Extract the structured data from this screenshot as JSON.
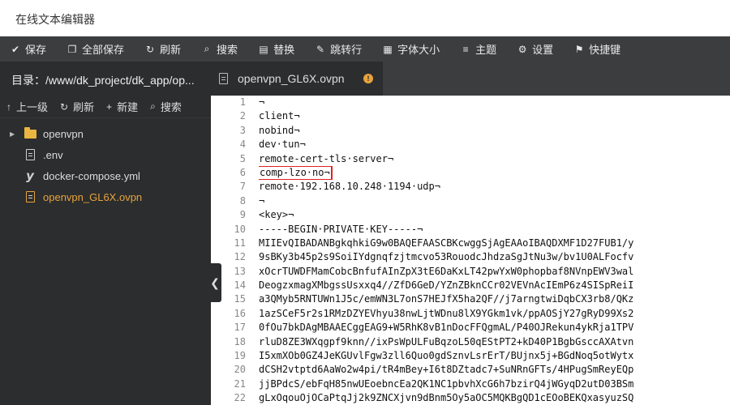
{
  "window": {
    "title": "在线文本编辑器"
  },
  "toolbar": {
    "buttons": [
      {
        "icon": "check-icon",
        "glyph": "✔",
        "label": "保存"
      },
      {
        "icon": "save-all-icon",
        "glyph": "❐",
        "label": "全部保存"
      },
      {
        "icon": "refresh-icon",
        "glyph": "↻",
        "label": "刷新"
      },
      {
        "icon": "search-icon",
        "glyph": "⌕",
        "label": "搜索"
      },
      {
        "icon": "replace-icon",
        "glyph": "▤",
        "label": "替换"
      },
      {
        "icon": "goto-line-icon",
        "glyph": "✎",
        "label": "跳转行"
      },
      {
        "icon": "font-size-icon",
        "glyph": "▦",
        "label": "字体大小"
      },
      {
        "icon": "theme-icon",
        "glyph": "≡",
        "label": "主题"
      },
      {
        "icon": "settings-icon",
        "glyph": "⚙",
        "label": "设置"
      },
      {
        "icon": "shortcut-icon",
        "glyph": "⚑",
        "label": "快捷键"
      }
    ]
  },
  "sidebar": {
    "path": "目录：/www/dk_project/dk_app/op...",
    "actions": [
      {
        "icon": "up-icon",
        "glyph": "↑",
        "label": "上一级"
      },
      {
        "icon": "refresh-icon",
        "glyph": "↻",
        "label": "刷新"
      },
      {
        "icon": "plus-icon",
        "glyph": "+",
        "label": "新建"
      },
      {
        "icon": "search-icon",
        "glyph": "⌕",
        "label": "搜索"
      }
    ],
    "tree": [
      {
        "type": "folder",
        "icon": "folder-icon",
        "label": "openvpn"
      },
      {
        "type": "file",
        "icon": "file-icon",
        "label": ".env"
      },
      {
        "type": "yaml",
        "icon": "yaml-icon",
        "label": "docker-compose.yml"
      },
      {
        "type": "file",
        "icon": "file-icon",
        "label": "openvpn_GL6X.ovpn",
        "active": true
      }
    ]
  },
  "tab": {
    "label": "openvpn_GL6X.ovpn",
    "badge": "!"
  },
  "editor": {
    "line_numbers": [
      "1",
      "2",
      "3",
      "4",
      "5",
      "6",
      "7",
      "8",
      "9",
      "10",
      "11",
      "12",
      "13",
      "14",
      "15",
      "16",
      "17",
      "18",
      "19",
      "20",
      "21",
      "22"
    ],
    "lines": [
      "¬",
      "client¬",
      "nobind¬",
      "dev·tun¬",
      "remote-cert-tls·server¬",
      "comp-lzo·no¬",
      "remote·192.168.10.248·1194·udp¬",
      "¬",
      "<key>¬",
      "-----BEGIN·PRIVATE·KEY-----¬",
      "MIIEvQIBADANBgkqhkiG9w0BAQEFAASCBKcwggSjAgEAAoIBAQDXMF1D27FUB1/y",
      "9sBKy3b45p2s9SoiIYdgnqfzjtmcvo53RouodcJhdzaSgJtNu3w/bv1U0ALFocfv",
      "xOcrTUWDFMamCobcBnfufAInZpX3tE6DaKxLT42pwYxW0phopbaf8NVnpEWV3wal",
      "DeogzxmagXMbgssUsxxq4//ZfD6GeD/YZnZBknCCr02VEVnAcIEmP6z4SISpReiI",
      "a3QMyb5RNTUWn1J5c/emWN3L7onS7HEJfX5ha2QF//j7arngtwiDqbCX3rb8/QKz",
      "1azSCeF5r2s1RMzDZYEVhyu38nwLjtWDnu8lX9YGkm1vk/ppAOSjY27gRyD99Xs2",
      "0fOu7bkDAgMBAAECggEAG9+W5RhK8vB1nDocFFQgmAL/P40OJRekun4ykRja1TPV",
      "rluD8ZE3WXqgpf9knn//ixPsWpULFuBqzoL50qEStPT2+kD40P1BgbGsccAXAtvn",
      "I5xmXOb0GZ4JeKGUvlFgw3zll6Quo0gdSznvLsrErT/BUjnx5j+BGdNoq5otWytx",
      "dCSH2vtptd6AaWo2w4pi/tR4mBey+I6t8DZtadc7+SuNRnGFTs/4HPugSmReyEQp",
      "jjBPdcS/ebFqH85nwUEoebncEa2QK1NC1pbvhXcG6h7bzirQ4jWGyqD2utD03BSm",
      "gLxOqouOjOCaPtqJj2k9ZNCXjvn9dBnm5Oy5aOC5MQKBgQD1cEOoBEKQxasyuzSQ"
    ],
    "highlighted_line": 6
  },
  "colors": {
    "toolbar_bg": "#3b3d3f",
    "sidebar_bg": "#2b2d2e",
    "active_file": "#e8a33d",
    "highlight_box": "#e02020"
  }
}
